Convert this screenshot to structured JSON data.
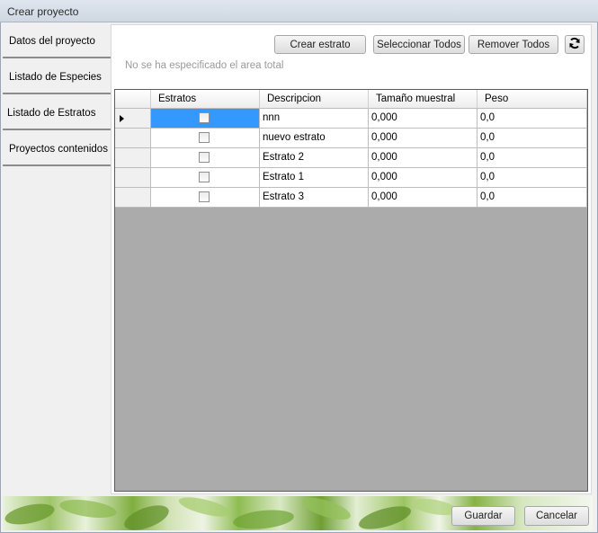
{
  "window": {
    "title": "Crear proyecto"
  },
  "sidebar": {
    "tabs": [
      {
        "label": "Datos del proyecto"
      },
      {
        "label": "Listado de Especies"
      },
      {
        "label": "Listado de Estratos"
      },
      {
        "label": "Proyectos contenidos"
      }
    ],
    "active_index": 2
  },
  "toolbar": {
    "crear_label": "Crear estrato",
    "seleccionar_label": "Seleccionar Todos",
    "remover_label": "Remover Todos",
    "refresh_icon": "refresh-icon"
  },
  "notice": "No se ha especificado el area total",
  "grid": {
    "columns": [
      "Estratos",
      "Descripcion",
      "Tamaño muestral",
      "Peso"
    ],
    "rows": [
      {
        "checked": false,
        "descripcion": "nnn",
        "tamano": "0,000",
        "peso": "0,0",
        "current": true
      },
      {
        "checked": false,
        "descripcion": "nuevo estrato",
        "tamano": "0,000",
        "peso": "0,0",
        "current": false
      },
      {
        "checked": false,
        "descripcion": "Estrato 2",
        "tamano": "0,000",
        "peso": "0,0",
        "current": false
      },
      {
        "checked": false,
        "descripcion": "Estrato 1",
        "tamano": "0,000",
        "peso": "0,0",
        "current": false
      },
      {
        "checked": false,
        "descripcion": "Estrato 3",
        "tamano": "0,000",
        "peso": "0,0",
        "current": false
      }
    ],
    "selected_color": "#3399ff"
  },
  "footer": {
    "guardar_label": "Guardar",
    "cancelar_label": "Cancelar"
  }
}
